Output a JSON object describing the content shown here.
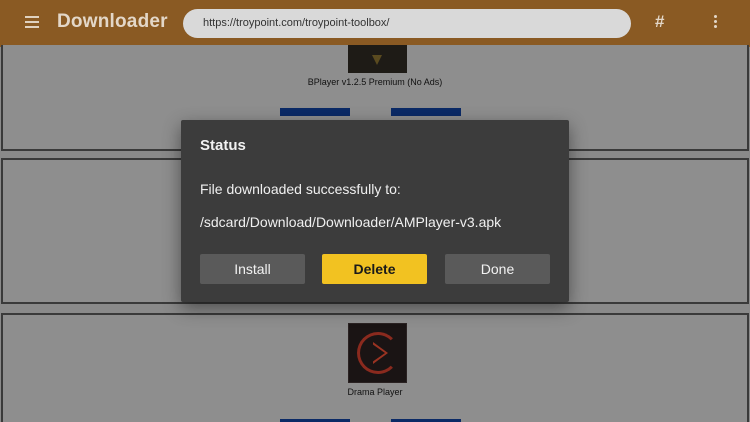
{
  "appbar": {
    "title": "Downloader",
    "url": "https://troypoint.com/troypoint-toolbox/",
    "hash_label": "#",
    "icons": [
      "menu-icon",
      "hash-icon",
      "overflow-menu-icon"
    ]
  },
  "list": {
    "items": [
      {
        "label": "BPlayer v1.2.5 Premium (No Ads)"
      },
      {
        "label": ""
      },
      {
        "label": "Drama Player"
      }
    ]
  },
  "dialog": {
    "title": "Status",
    "message": "File downloaded successfully to:",
    "path": "/sdcard/Download/Downloader/AMPlayer-v3.apk",
    "buttons": {
      "install": "Install",
      "delete": "Delete",
      "done": "Done"
    }
  },
  "colors": {
    "appbar": "#8a5a23",
    "accent": "#f2c221",
    "dialog_bg": "#3c3c3c",
    "dimmed_bg": "#8a8a8a"
  }
}
